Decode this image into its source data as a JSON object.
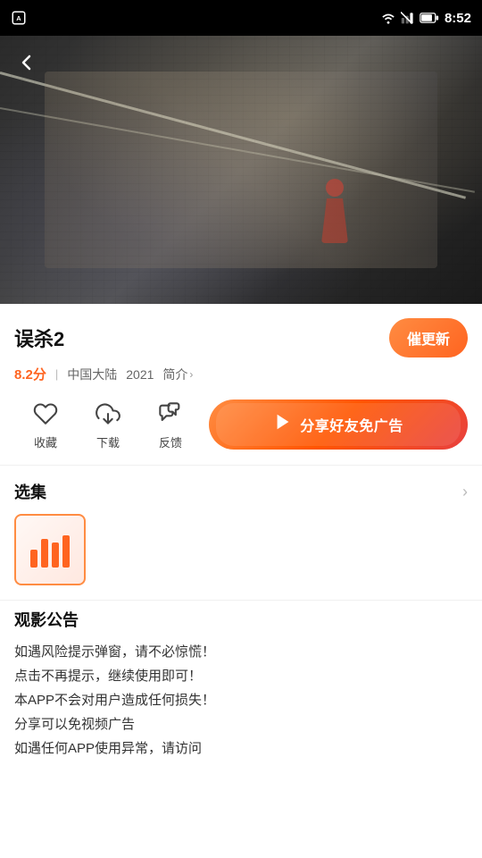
{
  "statusBar": {
    "time": "8:52",
    "icons": [
      "wifi",
      "signal-off",
      "battery"
    ]
  },
  "video": {
    "altText": "Movie scene - dark industrial setting with figure on cable"
  },
  "backButton": {
    "label": "‹"
  },
  "movieInfo": {
    "title": "误杀2",
    "score": "8.2分",
    "origin": "中国大陆",
    "year": "2021",
    "introLabel": "简介",
    "updateButtonLabel": "催更新"
  },
  "actions": {
    "favorite": "收藏",
    "download": "下载",
    "feedback": "反馈",
    "shareAd": "分享好友免广告"
  },
  "episodes": {
    "sectionTitle": "选集"
  },
  "notice": {
    "title": "观影公告",
    "lines": [
      "如遇风险提示弹窗，请不必惊慌！",
      "点击不再提示，继续使用即可！",
      "本APP不会对用户造成任何损失！",
      "分享可以免视频广告",
      "如遇任何APP使用异常，请访问"
    ]
  }
}
